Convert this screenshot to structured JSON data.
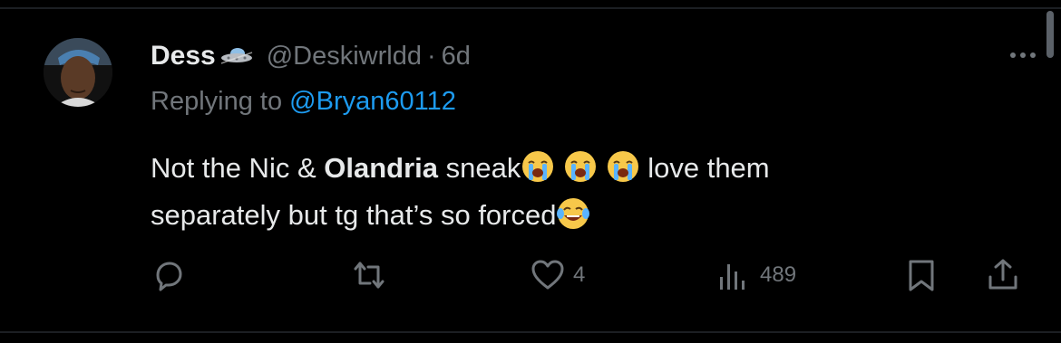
{
  "tweet": {
    "display_name": "Dess",
    "handle": "@Deskiwrldd",
    "separator": "·",
    "time": "6d",
    "replying_prefix": "Replying to ",
    "replying_to": "@Bryan60112",
    "text_part1": "Not the Nic & ",
    "text_bold": "Olandria",
    "text_part2": " sneak",
    "text_part3": " love them",
    "text_part4": "separately but tg that’s so forced",
    "emojis": [
      "loudly-crying-face",
      "loudly-crying-face",
      "loudly-crying-face",
      "face-with-tears-of-joy"
    ]
  },
  "actions": {
    "reply": {
      "icon": "reply-icon",
      "count": ""
    },
    "repost": {
      "icon": "repost-icon",
      "count": ""
    },
    "like": {
      "icon": "heart-icon",
      "count": "4"
    },
    "views": {
      "icon": "views-icon",
      "count": "489"
    },
    "bookmark": {
      "icon": "bookmark-icon"
    },
    "share": {
      "icon": "share-icon"
    }
  },
  "colors": {
    "background": "#000000",
    "text": "#e7e9ea",
    "muted": "#71767b",
    "link": "#1d9bf0"
  }
}
